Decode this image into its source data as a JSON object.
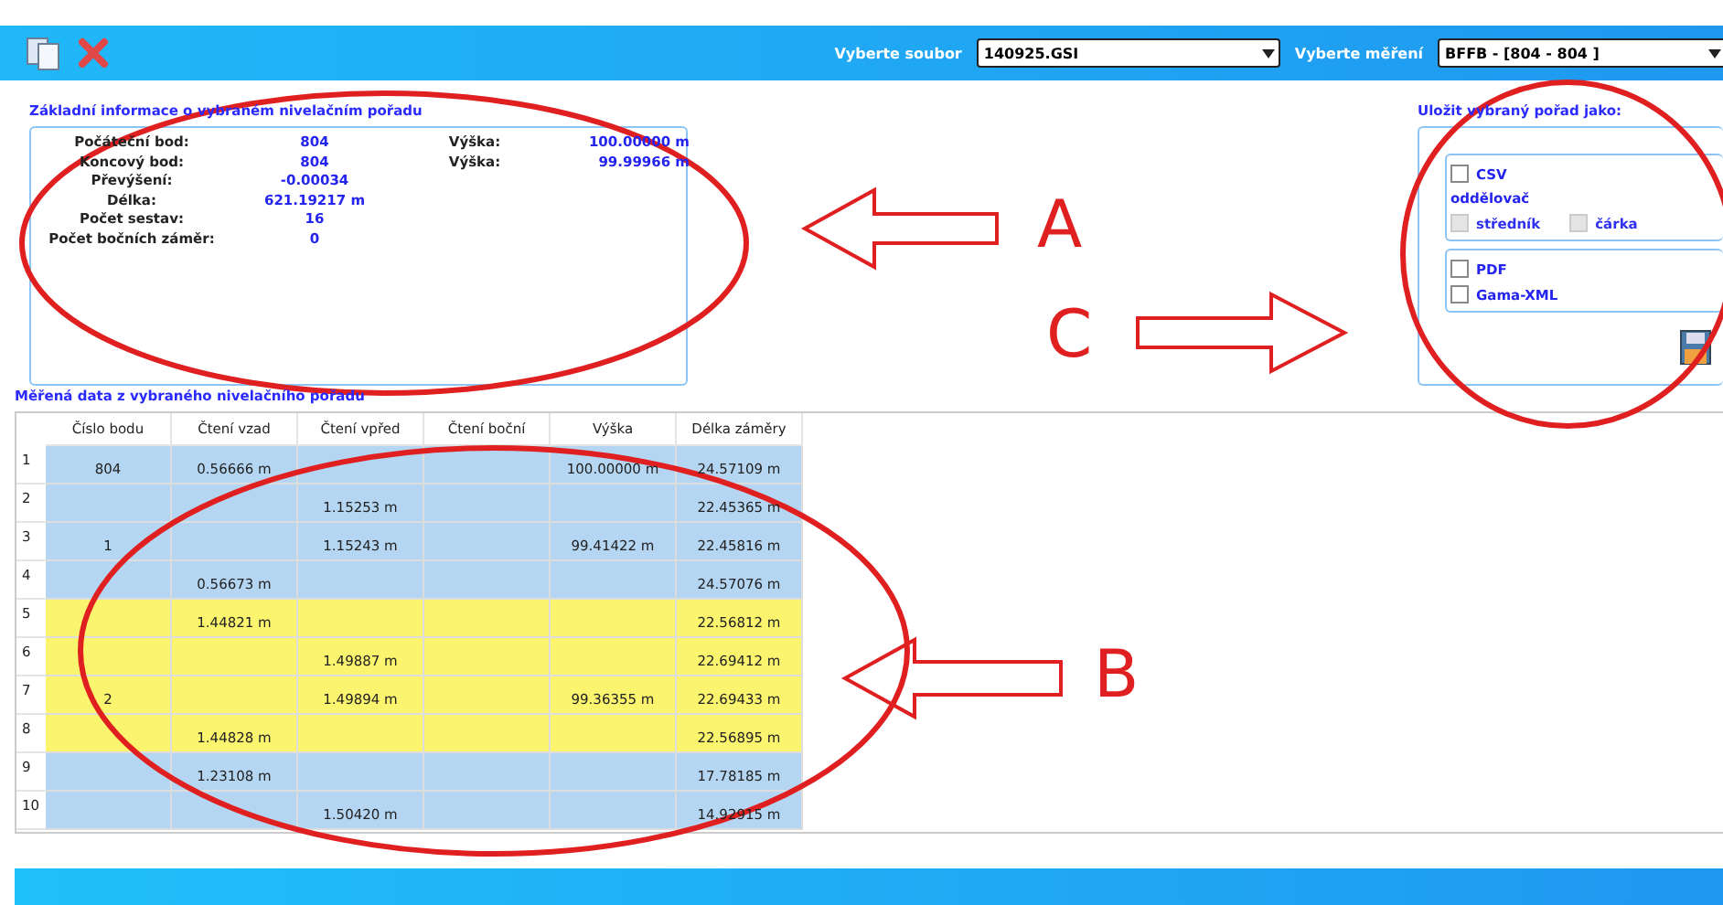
{
  "toolbar": {
    "file_label": "Vyberte soubor",
    "file_value": "140925.GSI",
    "measure_label": "Vyberte měření",
    "measure_value": "BFFB - [804 - 804 ]"
  },
  "info": {
    "title": "Základní informace o vybraném nivelačním pořadu",
    "rows": [
      {
        "label": "Počáteční bod:",
        "value": "804",
        "label2": "Výška:",
        "value2": "100.00000  m"
      },
      {
        "label": "Koncový bod:",
        "value": "804",
        "label2": "Výška:",
        "value2": "99.99966  m"
      },
      {
        "label": "Převýšení:",
        "value": "-0.00034"
      },
      {
        "label": "Délka:",
        "value": "621.19217  m"
      },
      {
        "label": "Počet sestav:",
        "value": "16"
      },
      {
        "label": "Počet bočních záměr:",
        "value": "0"
      }
    ]
  },
  "export": {
    "title": "Uložit vybraný pořad jako:",
    "csv": {
      "label": "CSV",
      "checked": false
    },
    "separator_label": "oddělovač",
    "separators": [
      {
        "label": "středník",
        "checked": false,
        "disabled": true
      },
      {
        "label": "čárka",
        "checked": false,
        "disabled": true
      }
    ],
    "formats": [
      {
        "label": "PDF",
        "checked": false
      },
      {
        "label": "Gama-XML",
        "checked": false
      }
    ]
  },
  "table": {
    "title": "Měřená data z vybraného nivelačního pořadu",
    "columns": [
      "Číslo bodu",
      "Čtení vzad",
      "Čtení vpřed",
      "Čtení boční",
      "Výška",
      "Délka záměry"
    ],
    "rows": [
      {
        "number": "1",
        "color": "#b4d6f2",
        "cells": [
          "804",
          "0.56666  m",
          "",
          "",
          "100.00000  m",
          "24.57109  m"
        ]
      },
      {
        "number": "2",
        "color": "#b4d6f2",
        "cells": [
          "",
          "",
          "1.15253  m",
          "",
          "",
          "22.45365  m"
        ]
      },
      {
        "number": "3",
        "color": "#b4d6f2",
        "cells": [
          "1",
          "",
          "1.15243  m",
          "",
          "99.41422  m",
          "22.45816  m"
        ]
      },
      {
        "number": "4",
        "color": "#b4d6f2",
        "cells": [
          "",
          "0.56673  m",
          "",
          "",
          "",
          "24.57076  m"
        ]
      },
      {
        "number": "5",
        "color": "#fbf46e",
        "cells": [
          "",
          "1.44821  m",
          "",
          "",
          "",
          "22.56812  m"
        ]
      },
      {
        "number": "6",
        "color": "#fbf46e",
        "cells": [
          "",
          "",
          "1.49887  m",
          "",
          "",
          "22.69412  m"
        ]
      },
      {
        "number": "7",
        "color": "#fbf46e",
        "cells": [
          "2",
          "",
          "1.49894  m",
          "",
          "99.36355  m",
          "22.69433  m"
        ]
      },
      {
        "number": "8",
        "color": "#fbf46e",
        "cells": [
          "",
          "1.44828  m",
          "",
          "",
          "",
          "22.56895  m"
        ]
      },
      {
        "number": "9",
        "color": "#b4d6f2",
        "cells": [
          "",
          "1.23108  m",
          "",
          "",
          "",
          "17.78185  m"
        ]
      },
      {
        "number": "10",
        "color": "#b4d6f2",
        "cells": [
          "",
          "",
          "1.50420  m",
          "",
          "",
          "14.92915  m"
        ]
      }
    ]
  },
  "annotations": [
    {
      "letter": "A"
    },
    {
      "letter": "B"
    },
    {
      "letter": "C"
    }
  ]
}
